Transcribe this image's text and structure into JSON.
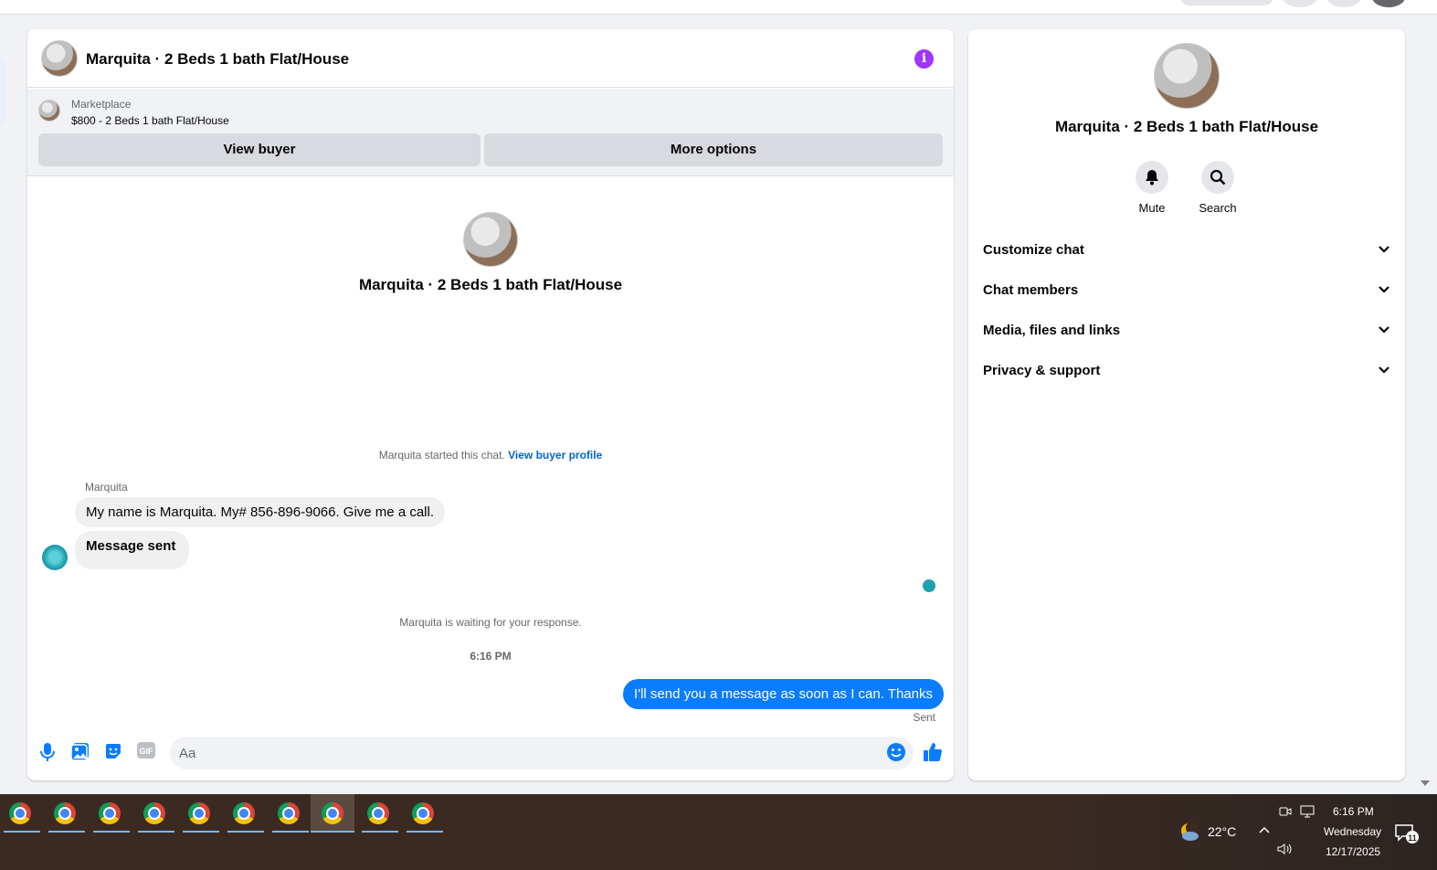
{
  "chat": {
    "title": "Marquita · 2 Beds 1 bath Flat/House",
    "listing_source": "Marketplace",
    "listing_price": "$800 - 2 Beds 1 bath Flat/House",
    "view_buyer_label": "View buyer",
    "more_options_label": "More options",
    "profile_name": "Marquita · 2 Beds 1 bath Flat/House",
    "started_text": "Marquita started this chat.",
    "view_buyer_profile_link": "View buyer profile",
    "sender_name": "Marquita",
    "messages_in": [
      "My name is Marquita. My# 856-896-9066. Give me a call.",
      "Message sent"
    ],
    "waiting_text": "Marquita is waiting for your response.",
    "timestamp": "6:16 PM",
    "message_out": "I'll send you a message as soon as I can. Thanks",
    "sent_status": "Sent",
    "composer_placeholder": "Aa",
    "composer_value": ""
  },
  "sidebar": {
    "name": "Marquita · 2 Beds 1 bath Flat/House",
    "mute_label": "Mute",
    "search_label": "Search",
    "sections": [
      "Customize chat",
      "Chat members",
      "Media, files and links",
      "Privacy & support"
    ]
  },
  "taskbar": {
    "weather_temp": "22°C",
    "clock_time": "6:16 PM",
    "clock_day": "Wednesday",
    "clock_date": "12/17/2025",
    "notification_count": "11"
  },
  "colors": {
    "accent_blue": "#0a7cff",
    "info_purple": "#a033ff",
    "link_blue": "#0064d1"
  }
}
